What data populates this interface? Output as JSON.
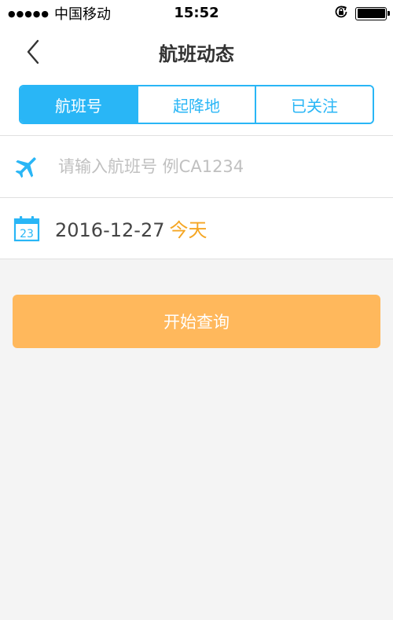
{
  "status_bar": {
    "signal": "●●●●●",
    "carrier": "中国移动",
    "time": "15:52",
    "lock_icon": "rotation-lock-icon",
    "battery_icon": "battery-icon"
  },
  "nav": {
    "back_icon": "chevron-left-icon",
    "title": "航班动态"
  },
  "tabs": [
    {
      "label": "航班号",
      "active": true
    },
    {
      "label": "起降地",
      "active": false
    },
    {
      "label": "已关注",
      "active": false
    }
  ],
  "flight_field": {
    "icon": "airplane-icon",
    "placeholder": "请输入航班号 例CA1234",
    "value": ""
  },
  "date_field": {
    "icon": "calendar-icon",
    "calendar_day": "23",
    "date": "2016-12-27",
    "relative": "今天"
  },
  "search_button": {
    "label": "开始查询"
  },
  "colors": {
    "accent": "#29b6f6",
    "today": "#f5a623",
    "button": "#ffb85c",
    "background": "#f4f4f4"
  }
}
